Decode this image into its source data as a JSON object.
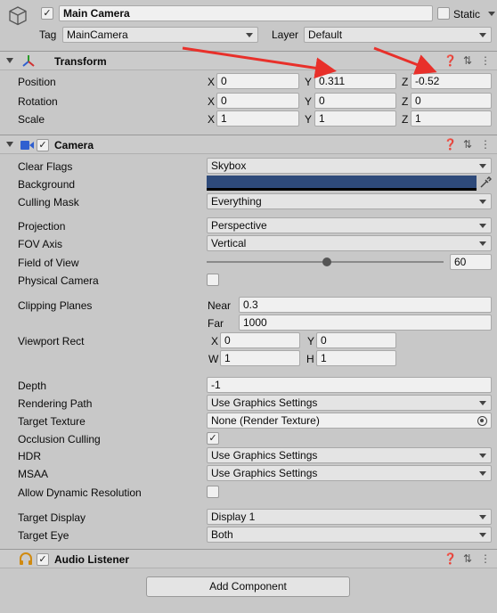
{
  "header": {
    "object_name": "Main Camera",
    "static_label": "Static",
    "tag_label": "Tag",
    "tag_value": "MainCamera",
    "layer_label": "Layer",
    "layer_value": "Default"
  },
  "transform": {
    "title": "Transform",
    "rows": [
      {
        "label": "Position",
        "x": "0",
        "y": "0.311",
        "z": "-0.52"
      },
      {
        "label": "Rotation",
        "x": "0",
        "y": "0",
        "z": "0"
      },
      {
        "label": "Scale",
        "x": "1",
        "y": "1",
        "z": "1"
      }
    ],
    "axis_x": "X",
    "axis_y": "Y",
    "axis_z": "Z"
  },
  "camera": {
    "title": "Camera",
    "clear_flags_label": "Clear Flags",
    "clear_flags_value": "Skybox",
    "background_label": "Background",
    "background_color": "#2e4a7a",
    "culling_mask_label": "Culling Mask",
    "culling_mask_value": "Everything",
    "projection_label": "Projection",
    "projection_value": "Perspective",
    "fov_axis_label": "FOV Axis",
    "fov_axis_value": "Vertical",
    "fov_label": "Field of View",
    "fov_value": "60",
    "fov_fraction": 0.507,
    "physical_label": "Physical Camera",
    "clipping_label": "Clipping Planes",
    "near_label": "Near",
    "near_value": "0.3",
    "far_label": "Far",
    "far_value": "1000",
    "viewport_label": "Viewport Rect",
    "vp_x_label": "X",
    "vp_x": "0",
    "vp_y_label": "Y",
    "vp_y": "0",
    "vp_w_label": "W",
    "vp_w": "1",
    "vp_h_label": "H",
    "vp_h": "1",
    "depth_label": "Depth",
    "depth_value": "-1",
    "rendering_path_label": "Rendering Path",
    "rendering_path_value": "Use Graphics Settings",
    "target_texture_label": "Target Texture",
    "target_texture_value": "None (Render Texture)",
    "occlusion_label": "Occlusion Culling",
    "hdr_label": "HDR",
    "hdr_value": "Use Graphics Settings",
    "msaa_label": "MSAA",
    "msaa_value": "Use Graphics Settings",
    "dyn_res_label": "Allow Dynamic Resolution",
    "target_display_label": "Target Display",
    "target_display_value": "Display 1",
    "target_eye_label": "Target Eye",
    "target_eye_value": "Both"
  },
  "audio": {
    "title": "Audio Listener"
  },
  "add_component_label": "Add Component",
  "colors": {
    "panel": "#c8c8c8",
    "arrow_red": "#e8302a",
    "axis_green": "#2a9a2a",
    "axis_blue": "#2f5fd0"
  }
}
